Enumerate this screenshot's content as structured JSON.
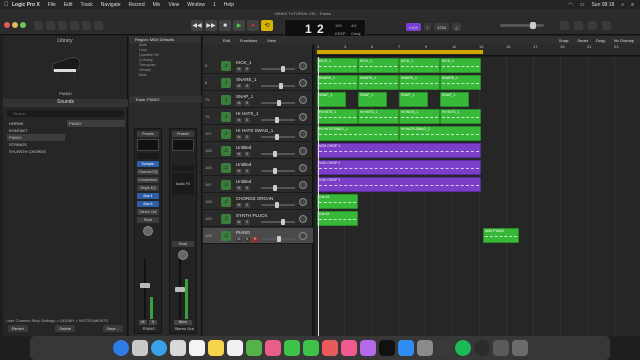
{
  "menubar": {
    "items": [
      "Logic Pro X",
      "File",
      "Edit",
      "Track",
      "Navigate",
      "Record",
      "Mix",
      "View",
      "Window",
      "1",
      "Help"
    ],
    "clock": "Sun 08:18"
  },
  "control_bar": {
    "window_title": "NINKS TUTORIAL VID - Tracks",
    "lcd_bar": "1",
    "lcd_beat": "2",
    "lcd_tempo": "100",
    "lcd_tempo_label": "KEEP",
    "lcd_sig": "4/4",
    "lcd_key": "Cmaj",
    "badge": "v104"
  },
  "library": {
    "title": "Library",
    "selected_patch": "PIANO",
    "sounds_header": "Sounds",
    "search_placeholder": "Search",
    "categories": [
      "HORNS",
      "KONTAKT",
      "PIANO",
      "STRINGS",
      "SYLENTH CHORDS"
    ],
    "subitems": [
      "PIANO"
    ],
    "footer_path": "User Channel Strip Settings > UDDMY > INSTRUMENTS",
    "revert": "Revert",
    "delete": "Delete",
    "save": "Save..."
  },
  "inspector": {
    "region_header": "Region: MIDI Defaults",
    "params": [
      "Mute",
      "Loop",
      "Quantize  Off",
      "Q-Swing",
      "Transpose",
      "Velocity"
    ],
    "more": "More",
    "track_header": "Track: PIANO",
    "strip1": {
      "slots": [
        "Presets",
        "EQ",
        "Sampler",
        "Channel EQ",
        "Compressor",
        "Single EQ",
        "Bus 4",
        "Bus 8",
        "Stereo Out",
        "Read"
      ],
      "value": "-1.6",
      "name": "PIANO"
    },
    "strip2": {
      "slots": [
        "Presets",
        "EQ",
        "Audio FX"
      ],
      "value": "0.0",
      "name": "Stereo Out",
      "read": "Read",
      "bounce": "Bnce"
    }
  },
  "tracks_toolbar": {
    "edit": "Edit",
    "functions": "Functions",
    "view": "View",
    "snap_label": "Snap:",
    "snap_value": "Smart",
    "drag_label": "Drag:",
    "drag_value": "No Overlap"
  },
  "ruler": [
    "1",
    "3",
    "5",
    "7",
    "9",
    "11",
    "13",
    "15",
    "17",
    "19",
    "21",
    "23",
    "25"
  ],
  "tracks": [
    {
      "num": "5",
      "name": "KICK_1",
      "icon": "♪"
    },
    {
      "num": "6",
      "name": "SNARE_1",
      "icon": "♪"
    },
    {
      "num": "75",
      "name": "SNAP_1",
      "icon": "♪"
    },
    {
      "num": "76",
      "name": "HI HATS_1",
      "icon": "♪"
    },
    {
      "num": "107",
      "name": "HI HATS SWAG_1",
      "icon": "♪"
    },
    {
      "num": "165",
      "name": "Untitled",
      "icon": "♫"
    },
    {
      "num": "166",
      "name": "Untitled",
      "icon": "♫"
    },
    {
      "num": "167",
      "name": "Untitled",
      "icon": "♫"
    },
    {
      "num": "168",
      "name": "CHORDS ORGAN",
      "icon": "♫"
    },
    {
      "num": "169",
      "name": "SYNTH PLUCK",
      "icon": "♫"
    },
    {
      "num": "100",
      "name": "PIANO",
      "icon": "♫"
    }
  ],
  "regions": {
    "kick": "KICK_1",
    "snare": "SNARE_1",
    "snap": "SNAP_1",
    "hats": "HI HATS_1",
    "swag": "HI HATS SWAG_1",
    "vox": "VOX CHOP 1",
    "organ": "Cat #3",
    "pluck": "Cat #3",
    "piano": "MIDI PIANO"
  },
  "colors": {
    "green": "#38b838",
    "purple": "#7b3ec9",
    "cycle": "#d2a800"
  }
}
